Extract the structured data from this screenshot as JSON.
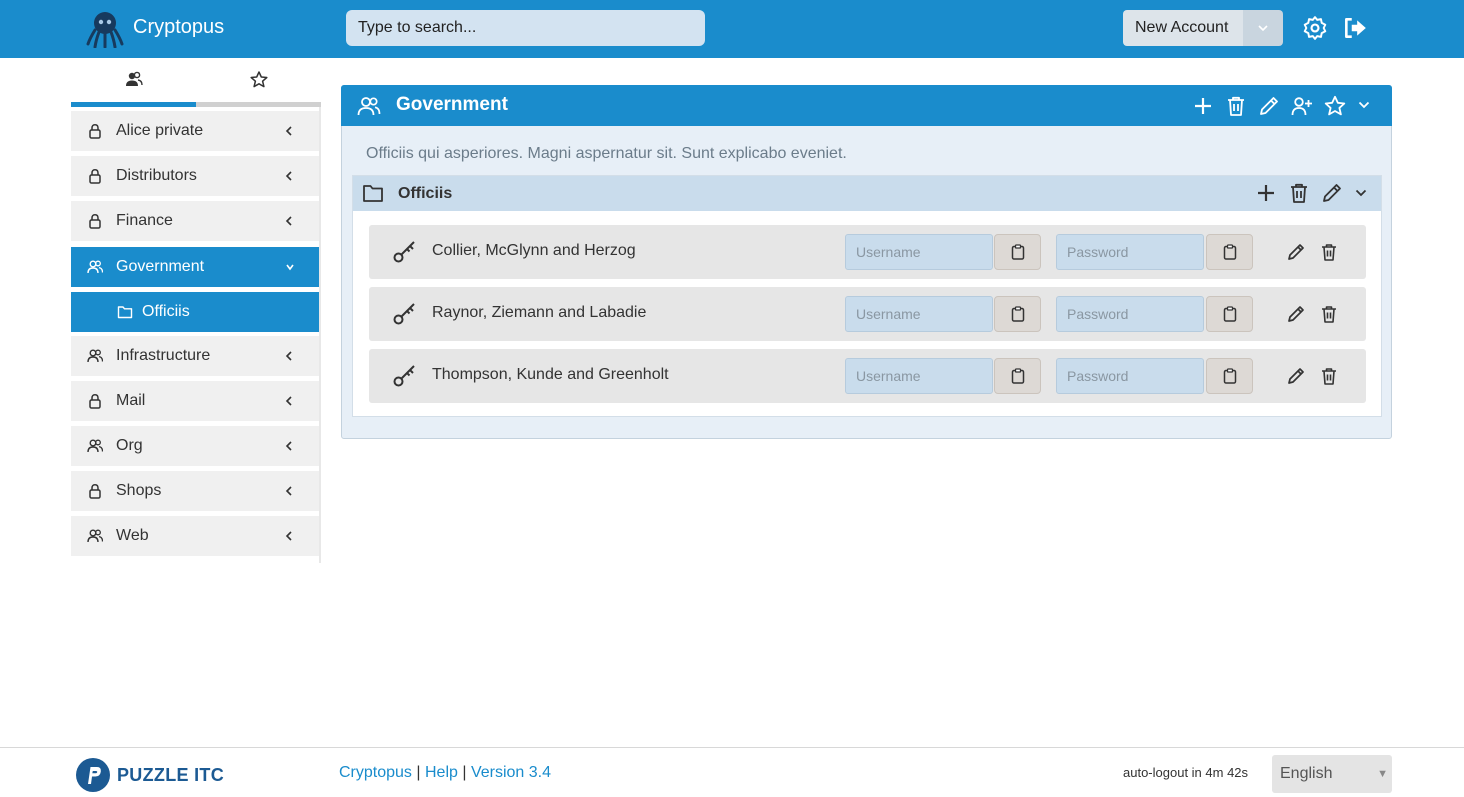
{
  "header": {
    "app_title": "Cryptopus",
    "search_placeholder": "Type to search...",
    "new_account_label": "New Account"
  },
  "sidebar": {
    "tabs": [
      {
        "name": "teams",
        "icon": "people-icon",
        "active": true
      },
      {
        "name": "favourites",
        "icon": "star-icon",
        "active": false
      }
    ],
    "items": [
      {
        "label": "Alice private",
        "icon": "lock-icon",
        "expanded": false
      },
      {
        "label": "Distributors",
        "icon": "lock-icon",
        "expanded": false
      },
      {
        "label": "Finance",
        "icon": "lock-icon",
        "expanded": false
      },
      {
        "label": "Government",
        "icon": "people-icon",
        "expanded": true,
        "active": true
      },
      {
        "label": "Officiis",
        "icon": "folder-icon",
        "sub": true
      },
      {
        "label": "Infrastructure",
        "icon": "people-icon",
        "expanded": false
      },
      {
        "label": "Mail",
        "icon": "lock-icon",
        "expanded": false
      },
      {
        "label": "Org",
        "icon": "people-icon",
        "expanded": false
      },
      {
        "label": "Shops",
        "icon": "lock-icon",
        "expanded": false
      },
      {
        "label": "Web",
        "icon": "people-icon",
        "expanded": false
      }
    ]
  },
  "team": {
    "title": "Government",
    "description": "Officiis qui asperiores. Magni aspernatur sit. Sunt explicabo eveniet.",
    "folder": {
      "title": "Officiis",
      "accounts": [
        {
          "name": "Collier, McGlynn and Herzog",
          "username_placeholder": "Username",
          "password_placeholder": "Password"
        },
        {
          "name": "Raynor, Ziemann and Labadie",
          "username_placeholder": "Username",
          "password_placeholder": "Password"
        },
        {
          "name": "Thompson, Kunde and Greenholt",
          "username_placeholder": "Username",
          "password_placeholder": "Password"
        }
      ]
    }
  },
  "footer": {
    "brand": "PUZZLE ITC",
    "link_cryptopus": "Cryptopus",
    "link_help": "Help",
    "link_version": "Version 3.4",
    "separator": "|",
    "autologout": "auto-logout in 4m 42s",
    "language": "English"
  },
  "colors": {
    "primary": "#1a8ccc",
    "panel_bg": "#e7eff7",
    "field_bg": "#c9dcec",
    "row_bg": "#e6e6e6"
  }
}
